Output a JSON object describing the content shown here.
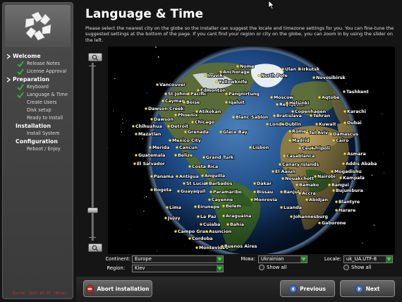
{
  "page": {
    "title": "Language & Time",
    "description": "Please select the nearest city on the globe so the installer can suggest the locale and timezone settings for you. You can fine-tune the suggested settings at the bottom of the page. If you cant find your region or city on the globe, you can zoom in by using the slider on the left."
  },
  "sidebar": {
    "build": "Build: 2013.02.07 (Beta)",
    "steps": [
      {
        "kind": "header",
        "label": "Welcome",
        "chevron": true
      },
      {
        "kind": "item",
        "label": "Release Notes",
        "done": true
      },
      {
        "kind": "item",
        "label": "License Approval",
        "done": true
      },
      {
        "kind": "header",
        "label": "Preparation",
        "chevron": true
      },
      {
        "kind": "item",
        "label": "Keyboard",
        "done": true
      },
      {
        "kind": "item",
        "label": "Language & Time",
        "done": true
      },
      {
        "kind": "item",
        "label": "Create Users",
        "done": false
      },
      {
        "kind": "item",
        "label": "Disk setup",
        "done": false
      },
      {
        "kind": "item",
        "label": "Ready to Install",
        "done": false
      },
      {
        "kind": "header",
        "label": "Installation",
        "chevron": false
      },
      {
        "kind": "item",
        "label": "Install System",
        "done": false
      },
      {
        "kind": "header",
        "label": "Configuration",
        "chevron": false
      },
      {
        "kind": "item",
        "label": "Reboot / Enjoy",
        "done": false
      }
    ]
  },
  "globe": {
    "cities": [
      "Nome",
      "Ulan Bator",
      "Irkutsk",
      "Inuvik",
      "Anchorage",
      "North Pole",
      "Novosibirsk",
      "Vancouver",
      "Yellowknife",
      "Edmonton",
      "Tashkent",
      "St Johns",
      "Pacific",
      "Pangnirtung",
      "Moscow",
      "Aqtobe",
      "Cayman",
      "Boise",
      "Iqaluit",
      "Reykjavik",
      "Helsinki",
      "Dawson Creek",
      "Atikokan",
      "Copenhagen",
      "Karachi",
      "Dawson",
      "Phoenix",
      "Blanc-Sablon",
      "Bratislava",
      "Tehran",
      "Chihuahua",
      "Detroit",
      "Chicago",
      "London",
      "Dublin",
      "Kuwait",
      "Dubai",
      "Mazatlan",
      "Grenada",
      "Glace Bay",
      "Rome",
      "Tel Aviv",
      "Damascus",
      "Mexico City",
      "Madrid",
      "Cairo",
      "Merida",
      "Cancun",
      "Lisbon",
      "Ceuta",
      "Tripoli",
      "Guatemala",
      "Belize",
      "Grand Turk",
      "Casablanca",
      "Asmara",
      "El Salvador",
      "Canary Islands",
      "Addis Ababa",
      "Costa Rica",
      "El Aaiun",
      "Mogadishu",
      "Panama",
      "Antigua",
      "Anguilla",
      "Nouakchott",
      "Nairobi",
      "Kampala",
      "St Lucia",
      "Barbados",
      "Dakar",
      "Bamako",
      "Bangui",
      "Bogota",
      "Guayaquil",
      "Paramaribo",
      "Bissau",
      "Banjul",
      "Accra",
      "Bujumbura",
      "Cayenne",
      "Monrovia",
      "Abidjan",
      "Lima",
      "Eirunepe",
      "Belem",
      "Luanda",
      "Blantyre",
      "Jujuy",
      "La Paz",
      "Araguaina",
      "Johannesburg",
      "Harare",
      "Cuiaba",
      "Bahia",
      "Gaborone",
      "Campo Grande",
      "Asuncion",
      "Cordoba",
      "Montevideo",
      "Buenos Aires"
    ]
  },
  "controls": {
    "continent_label": "Continent:",
    "continent_value": "Europe",
    "region_label": "Region:",
    "region_value": "Kiev",
    "language_label": "Мова:",
    "language_value": "Ukrainian",
    "locale_label": "Locale:",
    "locale_value": "uk_UA.UTF-8",
    "show_all_1": "Show all",
    "show_all_2": "Show all"
  },
  "buttons": {
    "abort": "Abort installation",
    "previous": "Previous",
    "next": "Next"
  },
  "colors": {
    "accent": "#2a6a2a",
    "danger": "#c03030",
    "check": "#3aa83a"
  }
}
